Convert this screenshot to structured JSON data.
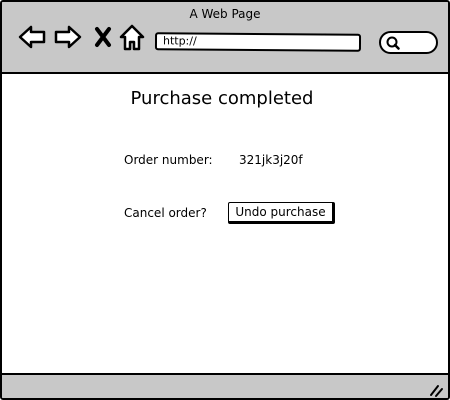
{
  "window": {
    "title": "A Web Page"
  },
  "toolbar": {
    "url": "http://",
    "icons": [
      "back-arrow-icon",
      "forward-arrow-icon",
      "close-icon",
      "home-icon",
      "search-icon"
    ]
  },
  "page": {
    "title": "Purchase completed",
    "order_number_label": "Order number:",
    "order_number_value": "321jk3j20f",
    "cancel_label": "Cancel order?",
    "undo_button_label": "Undo purchase"
  }
}
